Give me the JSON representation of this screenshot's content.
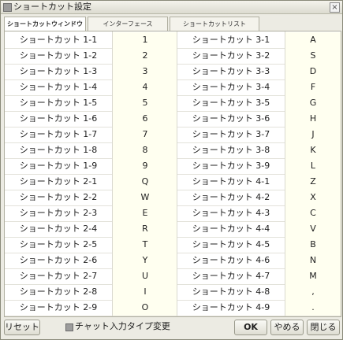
{
  "window": {
    "title": "ショートカット設定",
    "close_label": "×"
  },
  "tabs": [
    {
      "label": "ショートカットウィンドウ",
      "active": true
    },
    {
      "label": "インターフェース",
      "active": false
    },
    {
      "label": "ショートカットリスト",
      "active": false
    }
  ],
  "rows": [
    {
      "left_label": "ショートカット 1-1",
      "left_key": "1",
      "right_label": "ショートカット 3-1",
      "right_key": "A"
    },
    {
      "left_label": "ショートカット 1-2",
      "left_key": "2",
      "right_label": "ショートカット 3-2",
      "right_key": "S"
    },
    {
      "left_label": "ショートカット 1-3",
      "left_key": "3",
      "right_label": "ショートカット 3-3",
      "right_key": "D"
    },
    {
      "left_label": "ショートカット 1-4",
      "left_key": "4",
      "right_label": "ショートカット 3-4",
      "right_key": "F"
    },
    {
      "left_label": "ショートカット 1-5",
      "left_key": "5",
      "right_label": "ショートカット 3-5",
      "right_key": "G"
    },
    {
      "left_label": "ショートカット 1-6",
      "left_key": "6",
      "right_label": "ショートカット 3-6",
      "right_key": "H"
    },
    {
      "left_label": "ショートカット 1-7",
      "left_key": "7",
      "right_label": "ショートカット 3-7",
      "right_key": "J"
    },
    {
      "left_label": "ショートカット 1-8",
      "left_key": "8",
      "right_label": "ショートカット 3-8",
      "right_key": "K"
    },
    {
      "left_label": "ショートカット 1-9",
      "left_key": "9",
      "right_label": "ショートカット 3-9",
      "right_key": "L"
    },
    {
      "left_label": "ショートカット 2-1",
      "left_key": "Q",
      "right_label": "ショートカット 4-1",
      "right_key": "Z"
    },
    {
      "left_label": "ショートカット 2-2",
      "left_key": "W",
      "right_label": "ショートカット 4-2",
      "right_key": "X"
    },
    {
      "left_label": "ショートカット 2-3",
      "left_key": "E",
      "right_label": "ショートカット 4-3",
      "right_key": "C"
    },
    {
      "left_label": "ショートカット 2-4",
      "left_key": "R",
      "right_label": "ショートカット 4-4",
      "right_key": "V"
    },
    {
      "left_label": "ショートカット 2-5",
      "left_key": "T",
      "right_label": "ショートカット 4-5",
      "right_key": "B"
    },
    {
      "left_label": "ショートカット 2-6",
      "left_key": "Y",
      "right_label": "ショートカット 4-6",
      "right_key": "N"
    },
    {
      "left_label": "ショートカット 2-7",
      "left_key": "U",
      "right_label": "ショートカット 4-7",
      "right_key": "M"
    },
    {
      "left_label": "ショートカット 2-8",
      "left_key": "I",
      "right_label": "ショートカット 4-8",
      "right_key": ","
    },
    {
      "left_label": "ショートカット 2-9",
      "left_key": "O",
      "right_label": "ショートカット 4-9",
      "right_key": "."
    }
  ],
  "bottom": {
    "reset_label": "リセット",
    "chat_toggle_label": "チャット入力タイプ変更",
    "ok_label": "OK",
    "cancel_label": "やめる",
    "close_label": "閉じる"
  },
  "colors": {
    "key_cell_bg": "#fffff0",
    "window_bg": "#ecebe3"
  }
}
